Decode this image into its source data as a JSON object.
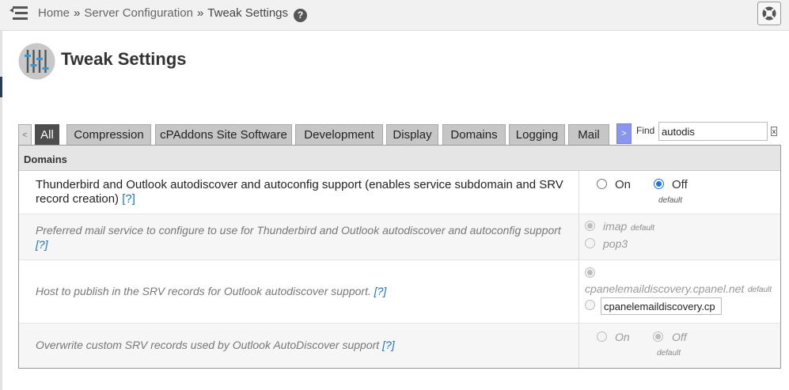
{
  "breadcrumb": {
    "home": "Home",
    "separator": "»",
    "section": "Server Configuration",
    "current": "Tweak Settings",
    "help_symbol": "?"
  },
  "page": {
    "title": "Tweak Settings"
  },
  "tabs": {
    "prev": "<",
    "next": ">",
    "items": [
      "All",
      "Compression",
      "cPAddons Site Software",
      "Development",
      "Display",
      "Domains",
      "Logging",
      "Mail"
    ],
    "active": "All"
  },
  "find": {
    "label": "Find",
    "value": "autodis",
    "clear": "x"
  },
  "panel": {
    "title": "Domains",
    "help_link": "[?]",
    "settings": [
      {
        "label": "Thunderbird and Outlook autodiscover and autoconfig support (enables service subdomain and SRV record creation)",
        "enabled": true,
        "options": [
          "On",
          "Off"
        ],
        "selected": "Off",
        "default_note": "default"
      },
      {
        "label": "Preferred mail service to configure to use for Thunderbird and Outlook autodiscover and autoconfig support",
        "enabled": false,
        "options": [
          "imap",
          "pop3"
        ],
        "selected": "imap",
        "default_note": "default"
      },
      {
        "label": "Host to publish in the SRV records for Outlook autodiscover support.",
        "enabled": false,
        "default_value": "cpanelemaildiscovery.cpanel.net",
        "default_note": "default",
        "custom_value": "cpanelemaildiscovery.cp"
      },
      {
        "label": "Overwrite custom SRV records used by Outlook AutoDiscover support",
        "enabled": false,
        "options": [
          "On",
          "Off"
        ],
        "selected": "Off",
        "default_note": "default"
      }
    ]
  },
  "colors": {
    "active_tab": "#4d4d4d",
    "tab": "#c6c6c6",
    "next_tab": "#8896ee",
    "link": "#1a73c9",
    "radio_checked": "#1a73e8"
  },
  "icons": {
    "menu": "hamburger-menu-icon",
    "help": "question-circle-icon",
    "support": "lifebuoy-icon",
    "page": "sliders-icon"
  }
}
